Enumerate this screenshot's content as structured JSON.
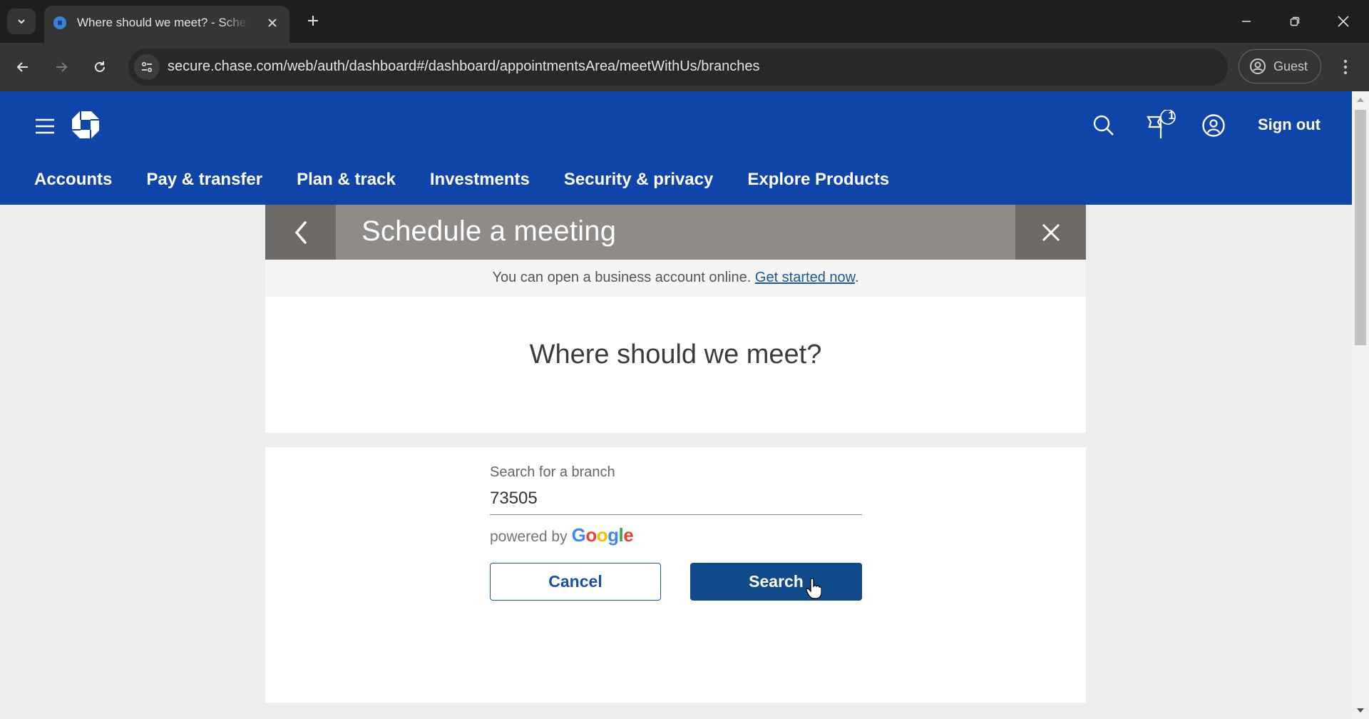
{
  "browser": {
    "tab_title": "Where should we meet? - Schedule a meeting",
    "url": "secure.chase.com/web/auth/dashboard#/dashboard/appointmentsArea/meetWithUs/branches",
    "profile_label": "Guest",
    "icons": {
      "tab_list": "chevron-down-icon",
      "favicon": "chase-favicon",
      "close_tab": "close-icon",
      "new_tab": "plus-icon",
      "back": "arrow-left-icon",
      "forward": "arrow-right-icon",
      "reload": "reload-icon",
      "site_info": "tune-icon",
      "profile": "account-circle-icon",
      "menu": "kebab-menu-icon",
      "minimize": "minimize-icon",
      "restore": "restore-icon",
      "close_window": "close-icon"
    }
  },
  "header": {
    "brand_color": "#0f45a8",
    "notifications_count": "1",
    "sign_out_label": "Sign out",
    "nav": [
      {
        "label": "Accounts"
      },
      {
        "label": "Pay & transfer"
      },
      {
        "label": "Plan & track"
      },
      {
        "label": "Investments"
      },
      {
        "label": "Security & privacy"
      },
      {
        "label": "Explore Products"
      }
    ]
  },
  "modal": {
    "title": "Schedule a meeting",
    "notice_text": "You can open a business account online.",
    "notice_link": "Get started now",
    "notice_end": ".",
    "heading": "Where should we meet?",
    "field_label": "Search for a branch",
    "field_value": "73505",
    "powered_by": "powered by",
    "google": [
      "G",
      "o",
      "o",
      "g",
      "l",
      "e"
    ],
    "cancel_label": "Cancel",
    "search_label": "Search",
    "primary_color": "#114a8a"
  }
}
